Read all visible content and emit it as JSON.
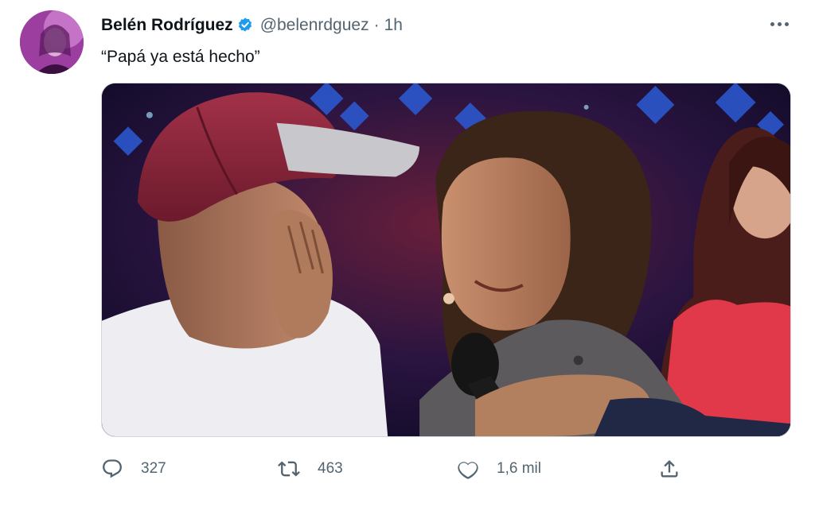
{
  "tweet": {
    "author_name": "Belén Rodríguez",
    "handle": "@belenrdguez",
    "separator": "·",
    "time": "1h",
    "text": "“Papá ya está hecho”",
    "verified_color": "#1d9bf0"
  },
  "media": {
    "description_icon": "photo"
  },
  "actions": {
    "reply_count": "327",
    "retweet_count": "463",
    "like_count": "1,6 mil"
  },
  "colors": {
    "text_primary": "#0f1419",
    "text_secondary": "#536471",
    "border": "#cfd9de"
  }
}
